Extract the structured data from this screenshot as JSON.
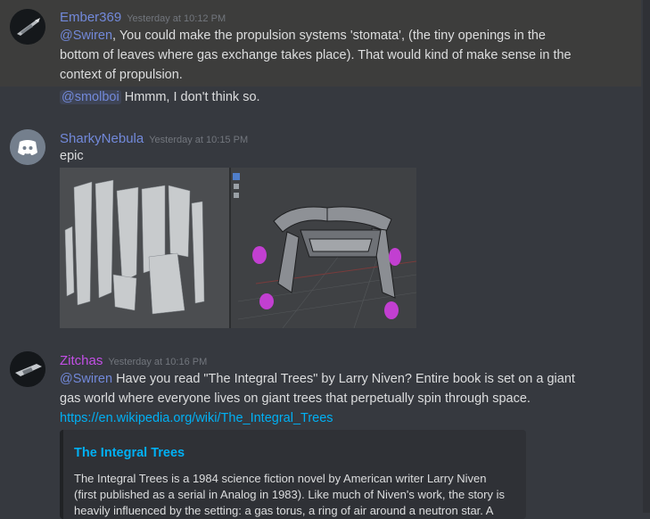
{
  "messages": {
    "ember": {
      "username": "Ember369",
      "username_color": "#7289da",
      "timestamp": "Yesterday at 10:12 PM",
      "mention1": "@Swiren",
      "line1_rest": ", You could make the propulsion systems 'stomata', (the tiny openings in the",
      "line2": "bottom of leaves where gas exchange takes place). That would kind of make sense in the",
      "line3": "context of propulsion.",
      "mention2": "@smolboi",
      "line4_rest": " Hmmm, I don't think so."
    },
    "sharky": {
      "username": "SharkyNebula",
      "username_color": "#7289da",
      "timestamp": "Yesterday at 10:15 PM",
      "text": "epic",
      "attachment_icon": "image-attachment"
    },
    "zitchas": {
      "username": "Zitchas",
      "username_color": "#c34fe6",
      "timestamp": "Yesterday at 10:16 PM",
      "mention": "@Swiren",
      "line1_rest": " Have you read \"The Integral Trees\" by Larry Niven? Entire book is set on a giant",
      "line2": "gas world where everyone lives on giant trees that perpetually spin through space.",
      "link": "https://en.wikipedia.org/wiki/The_Integral_Trees",
      "embed": {
        "title": "The Integral Trees",
        "desc1": "The Integral Trees is a 1984 science fiction novel by American writer Larry Niven",
        "desc2": "(first published as a serial in Analog in 1983). Like much of Niven's work, the story is",
        "desc3": "heavily influenced by the setting: a gas torus, a ring of air around a neutron star. A"
      }
    }
  }
}
